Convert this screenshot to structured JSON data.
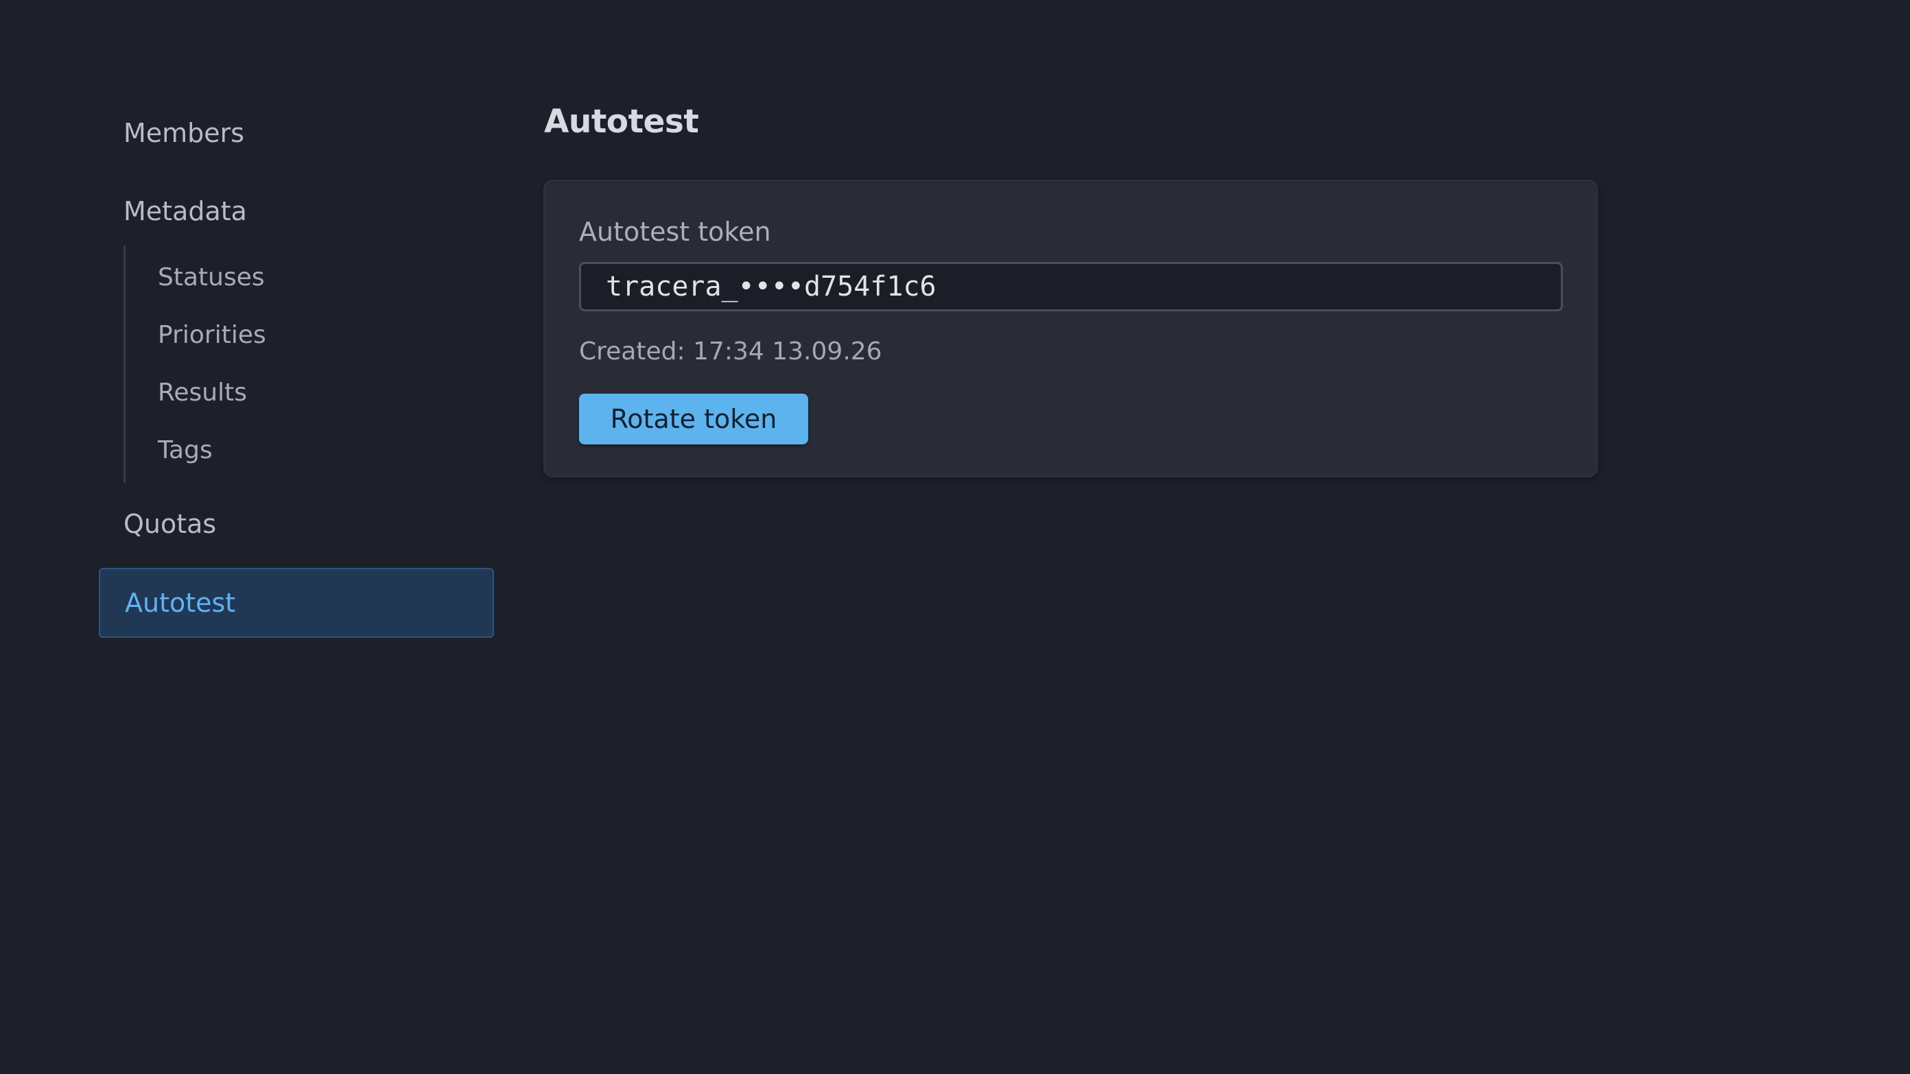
{
  "sidebar": {
    "items": [
      {
        "label": "Members"
      },
      {
        "label": "Metadata",
        "children": [
          {
            "label": "Statuses"
          },
          {
            "label": "Priorities"
          },
          {
            "label": "Results"
          },
          {
            "label": "Tags"
          }
        ]
      },
      {
        "label": "Quotas"
      },
      {
        "label": "Autotest",
        "active": true
      }
    ]
  },
  "main": {
    "title": "Autotest",
    "card": {
      "token_label": "Autotest token",
      "token_value": "tracera_••••d754f1c6",
      "created_label": "Created:",
      "created_value": "17:34 13.09.26",
      "rotate_button": "Rotate token"
    }
  },
  "colors": {
    "background": "#1d2029",
    "card": "#292c37",
    "accent": "#5cb3ee",
    "active_nav_bg": "#213854",
    "active_nav_text": "#5fb3f2"
  }
}
